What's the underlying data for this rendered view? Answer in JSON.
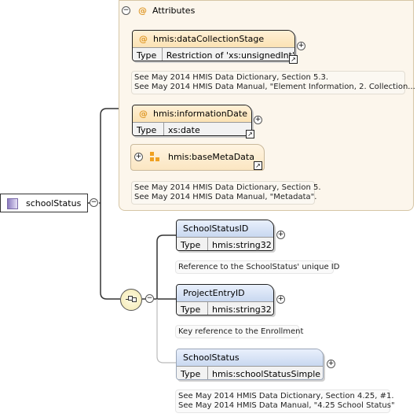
{
  "root": {
    "name": "schoolStatus"
  },
  "attributes": {
    "title": "Attributes",
    "items": [
      {
        "name": "hmis:dataCollectionStage",
        "type_label": "Type",
        "type_value": "Restriction of 'xs:unsignedInt'"
      },
      {
        "name": "hmis:informationDate",
        "type_label": "Type",
        "type_value": "xs:date"
      },
      {
        "name": "hmis:baseMetaData"
      }
    ],
    "docs": [
      [
        "See May 2014 HMIS Data Dictionary, Section 5.3.",
        "See May 2014 HMIS Data Manual, \"Element Information, 2. Collection..."
      ],
      [
        "See May 2014 HMIS Data Dictionary, Section 5.",
        "See May 2014 HMIS Data Manual, \"Metadata\"."
      ]
    ]
  },
  "elements": [
    {
      "name": "SchoolStatusID",
      "type_label": "Type",
      "type_value": "hmis:string32",
      "doc": [
        "Reference to the SchoolStatus' unique ID"
      ]
    },
    {
      "name": "ProjectEntryID",
      "type_label": "Type",
      "type_value": "hmis:string32",
      "doc": [
        "Key reference to the Enrollment"
      ]
    },
    {
      "name": "SchoolStatus",
      "type_label": "Type",
      "type_value": "hmis:schoolStatusSimple",
      "doc": [
        "See May 2014 HMIS Data Dictionary, Section 4.25, #1.",
        "See May 2014 HMIS Data Manual, \"4.25 School Status\""
      ]
    }
  ],
  "symbols": {
    "at": "@",
    "minus": "−",
    "plus": "+",
    "link": "↗"
  }
}
